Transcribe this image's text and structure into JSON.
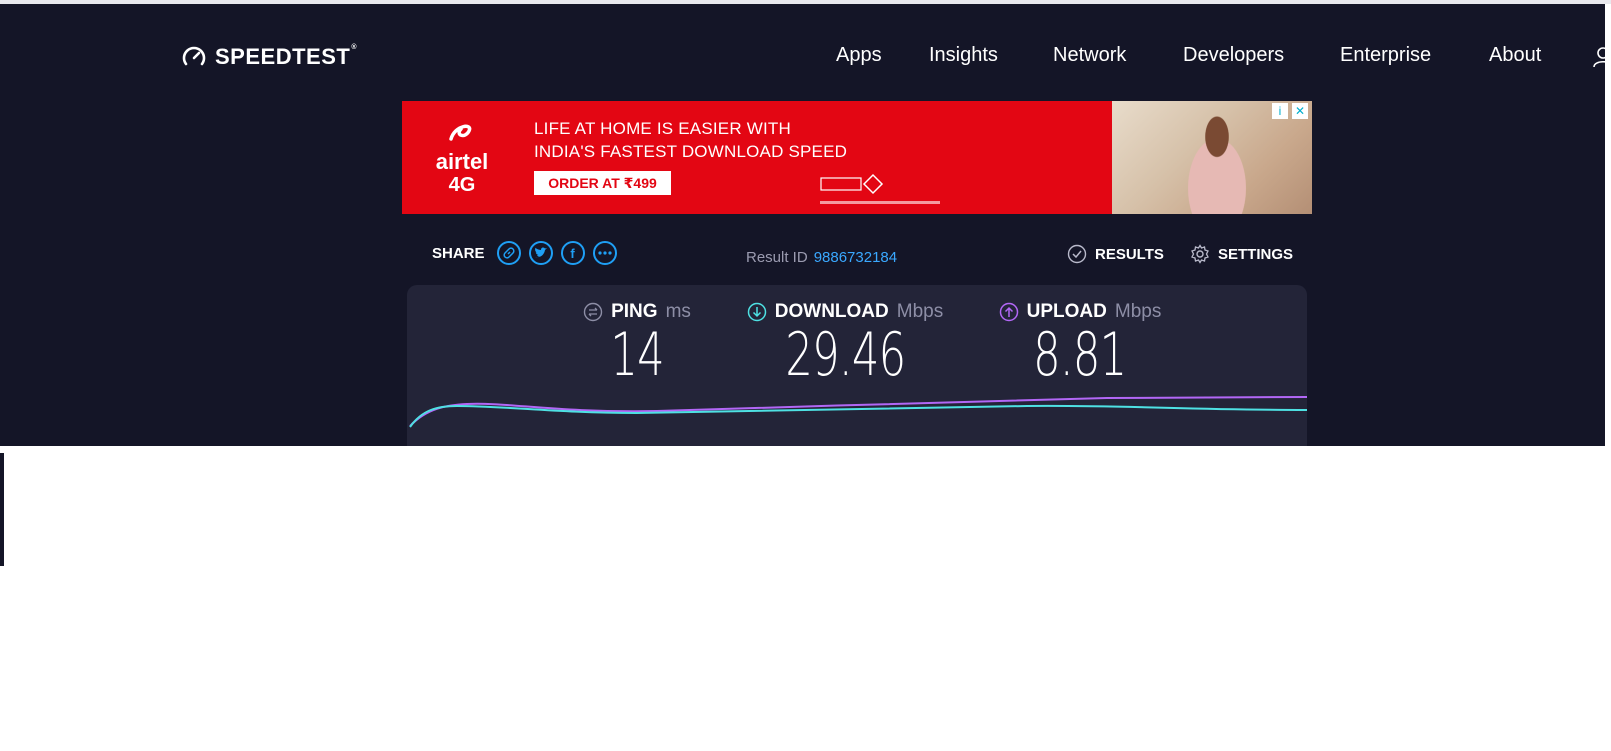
{
  "header": {
    "logo_text": "SPEEDTEST",
    "logo_tm": "®",
    "nav": [
      "Apps",
      "Insights",
      "Network",
      "Developers",
      "Enterprise",
      "About"
    ]
  },
  "ad": {
    "brand_line1": "airtel",
    "brand_line2": "4G",
    "headline1": "LIFE AT HOME IS EASIER WITH",
    "headline2": "INDIA'S FASTEST DOWNLOAD SPEED",
    "cta": "ORDER AT ₹499",
    "info_icon": "i",
    "close_icon": "✕"
  },
  "toolbar": {
    "share_label": "SHARE",
    "share_icons": [
      "link-icon",
      "twitter-icon",
      "facebook-icon",
      "more-icon"
    ],
    "result_id_label": "Result ID",
    "result_id_value": "9886732184",
    "results_label": "RESULTS",
    "settings_label": "SETTINGS"
  },
  "metrics": {
    "ping": {
      "label": "PING",
      "unit": "ms",
      "value": "14"
    },
    "download": {
      "label": "DOWNLOAD",
      "unit": "Mbps",
      "value": "29.46"
    },
    "upload": {
      "label": "UPLOAD",
      "unit": "Mbps",
      "value": "8.81"
    }
  },
  "colors": {
    "background": "#141527",
    "card": "#232438",
    "download_line": "#4ee1e3",
    "upload_line": "#b267f6",
    "accent_blue": "#1f9ff5",
    "ad_red": "#e30613"
  }
}
